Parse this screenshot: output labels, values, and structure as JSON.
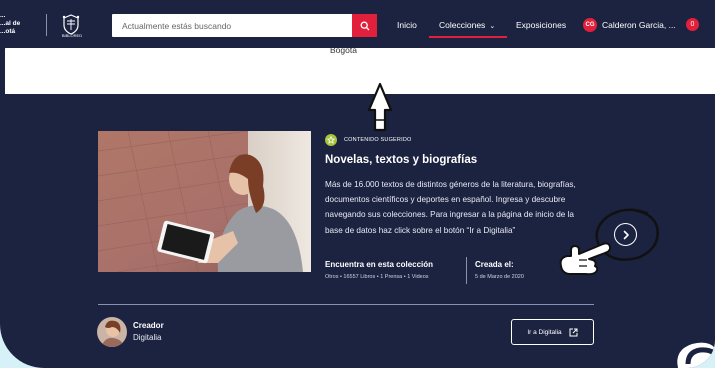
{
  "navbar": {
    "logo_text": [
      "...al de",
      "...otá"
    ],
    "logo_text_top": "...",
    "crest_label": "BIBLORED",
    "search_placeholder": "Actualmente estás buscando",
    "links": {
      "inicio": "Inicio",
      "colecciones": "Colecciones",
      "exposiciones": "Exposiciones"
    },
    "user": {
      "initials": "CG",
      "name": "Calderon Garcia, ...",
      "notifications": "0"
    }
  },
  "header_strip": {
    "location": "Bogotá"
  },
  "card": {
    "badge_label": "CONTENIDO SUGERIDO",
    "title": "Novelas, textos y biografías",
    "description": "Más de 16.000 textos de distintos géneros de la literatura, biografías, documentos científicos y deportes en español. Ingresa y descubre navegando sus colecciones. Para ingresar a la página de inicio de la base de datos haz click sobre el botón “Ir a Digitalia”",
    "found_title": "Encuentra en esta colección",
    "found_stats": "Otros • 16557 Libros • 1 Prensa • 1 Videos",
    "created_title": "Creada el:",
    "created_date": "5 de Marzo de 2020",
    "creator_role": "Creador",
    "creator_name": "Digitalia",
    "goto_label": "Ir a Digitalia"
  },
  "colors": {
    "navy": "#1c2340",
    "accent_red": "#e2203b",
    "badge_green": "#a7c43a",
    "background_teal": "#d6f1f7"
  },
  "icons": [
    "search-icon",
    "chevron-down-icon",
    "chevron-right-icon",
    "external-link-icon",
    "star-icon",
    "hand-pointer-icon"
  ]
}
